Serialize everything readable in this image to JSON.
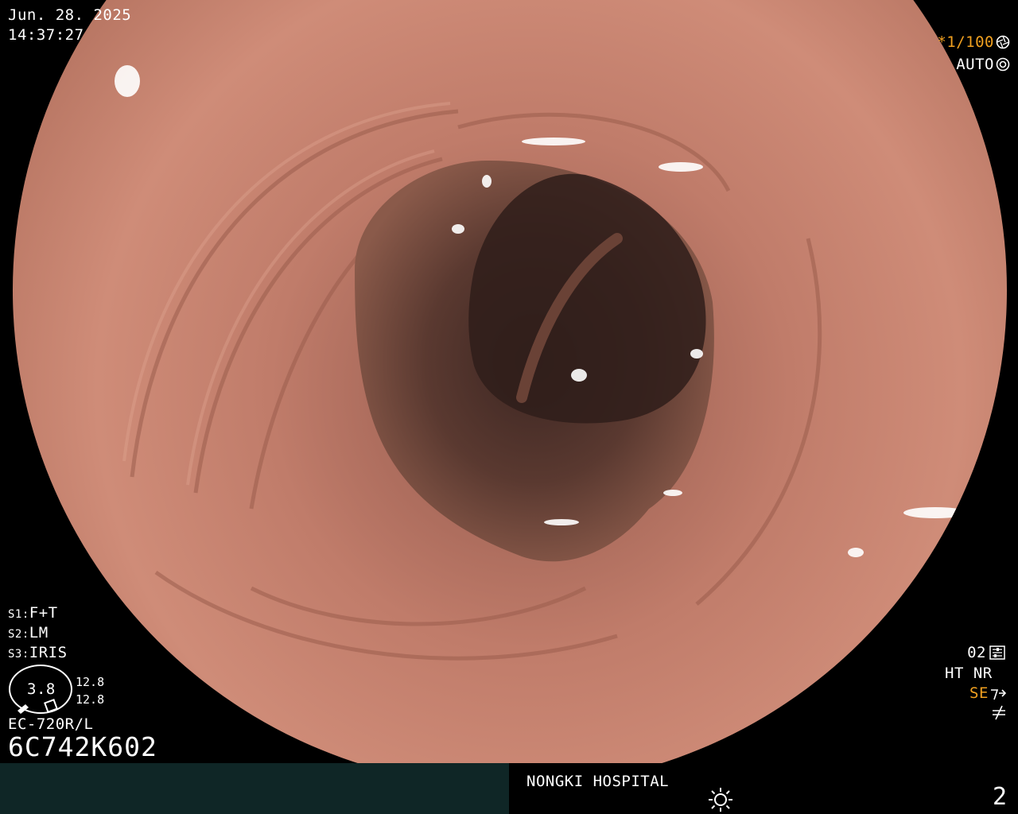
{
  "overlay": {
    "date": "Jun. 28. 2025",
    "time": "14:37:27",
    "shutter": "*1/100",
    "shutter_icon": "aperture-icon",
    "exposure_mode": "AUTO",
    "exposure_icon": "camera-lens-icon",
    "settings": {
      "s1_key": "S1:",
      "s1_value": "F+T",
      "s2_key": "S2:",
      "s2_value": "LM",
      "s3_key": "S3:",
      "s3_value": "IRIS"
    },
    "scope_gauge": {
      "value": "3.8",
      "upper": "12.8",
      "lower": "12.8"
    },
    "scope_model": "EC-720R/L",
    "scope_serial": "6C742K602",
    "right_status": {
      "mode_code": "02",
      "mode_icon": "sliders-icon",
      "ht": "HT",
      "nr": "NR",
      "se": "SE",
      "se_icon": "flash-icon",
      "no_flash_icon": "not-equal-icon"
    }
  },
  "footer": {
    "hospital": "NONGKI HOSPITAL",
    "brightness_icon": "sun-icon",
    "page_number": "2"
  },
  "colors": {
    "background": "#000000",
    "footer_left": "#0f2626",
    "accent_orange": "#f0a020",
    "mucosa": "#c98170",
    "lumen_dark": "#3a2420"
  }
}
